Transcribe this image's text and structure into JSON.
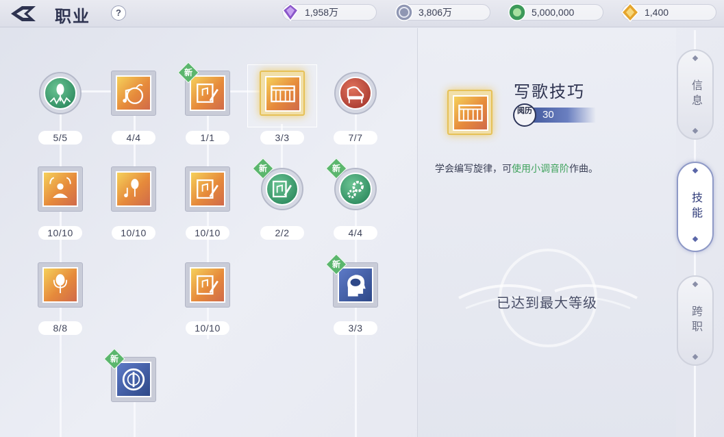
{
  "header": {
    "title": "职业",
    "help": "?"
  },
  "currencies": [
    {
      "value": "1,958万",
      "icon": "purple-crystal-icon"
    },
    {
      "value": "3,806万",
      "icon": "silver-coin-icon"
    },
    {
      "value": "5,000,000",
      "icon": "green-coin-icon"
    },
    {
      "value": "1,400",
      "icon": "gold-gem-icon"
    }
  ],
  "nodes": [
    {
      "label": "5/5",
      "icon": "microphone-wave-icon",
      "new": ""
    },
    {
      "label": "4/4",
      "icon": "music-note-fruit-icon",
      "new": ""
    },
    {
      "label": "1/1",
      "icon": "music-sheet-icon",
      "new": "新"
    },
    {
      "label": "3/3",
      "icon": "piano-icon",
      "new": ""
    },
    {
      "label": "7/7",
      "icon": "grand-piano-icon",
      "new": ""
    },
    {
      "label": "10/10",
      "icon": "spotlight-person-icon",
      "new": ""
    },
    {
      "label": "10/10",
      "icon": "microphone-note-icon",
      "new": ""
    },
    {
      "label": "10/10",
      "icon": "music-sheet-icon",
      "new": ""
    },
    {
      "label": "2/2",
      "icon": "music-sheet-icon",
      "new": "新"
    },
    {
      "label": "4/4",
      "icon": "gears-icon",
      "new": "新"
    },
    {
      "label": "8/8",
      "icon": "microphone-icon",
      "new": ""
    },
    {
      "label": "10/10",
      "icon": "music-sheet-icon",
      "new": ""
    },
    {
      "label": "3/3",
      "icon": "brain-head-icon",
      "new": "新"
    },
    {
      "label": "",
      "icon": "emblem-icon",
      "new": "新"
    }
  ],
  "detail": {
    "name": "写歌技巧",
    "emblem": "阅历",
    "exp": "30",
    "desc_pre": "学会编写旋律，可",
    "desc_hl": "使用小调音阶",
    "desc_post": "作曲。",
    "max": "已达到最大等级"
  },
  "tabs": [
    {
      "label": "信息"
    },
    {
      "label": "技能"
    },
    {
      "label": "跨职"
    }
  ],
  "colors": {
    "orange": "#e68a3b",
    "green": "#1f7d53",
    "blue": "#2e4888",
    "red": "#9c2d26",
    "highlight": "#3fa25c"
  }
}
